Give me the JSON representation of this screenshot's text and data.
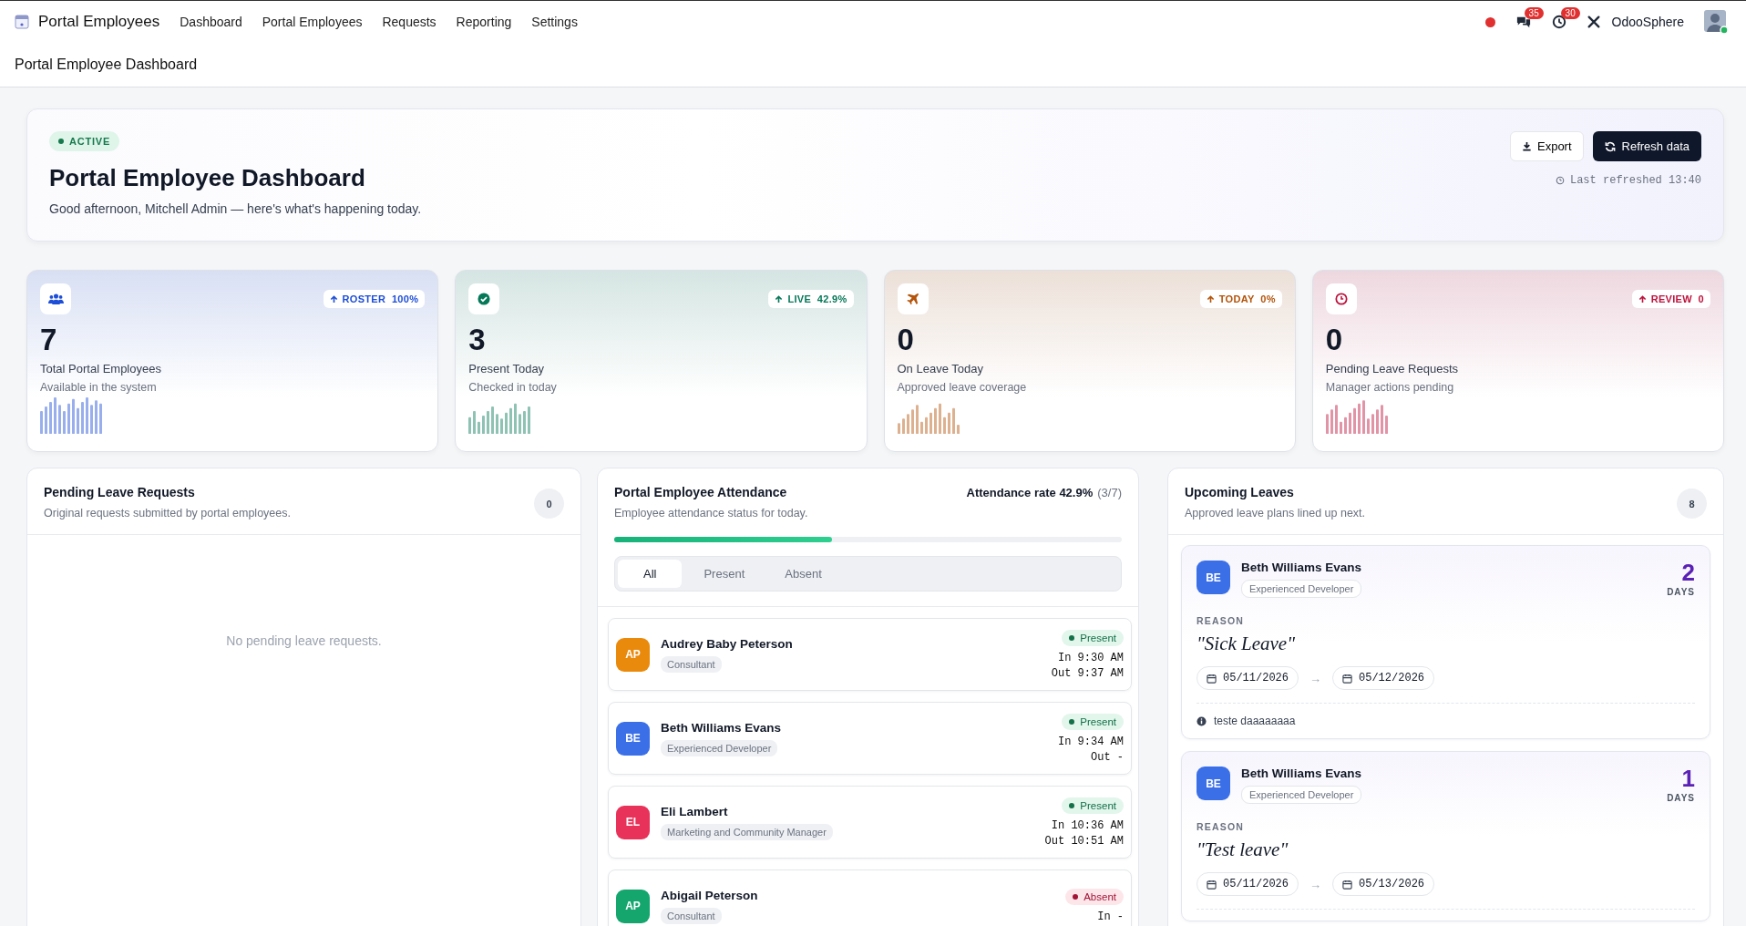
{
  "nav": {
    "brand": "Portal Employees",
    "menu": [
      {
        "label": "Dashboard"
      },
      {
        "label": "Portal Employees"
      },
      {
        "label": "Requests"
      },
      {
        "label": "Reporting"
      },
      {
        "label": "Settings"
      }
    ],
    "chat_count": "35",
    "activity_count": "30",
    "company": "OdooSphere"
  },
  "breadcrumb": "Portal Employee Dashboard",
  "hero": {
    "status": "ACTIVE",
    "title": "Portal Employee Dashboard",
    "greeting": "Good afternoon, Mitchell Admin — here's what's happening today.",
    "export": "Export",
    "refresh": "Refresh data",
    "last_refreshed": "Last refreshed 13:40"
  },
  "stats": [
    {
      "kind": "people",
      "color": "#1d4ed8",
      "badge_label": "ROSTER",
      "badge_value": "100%",
      "value": "7",
      "label": "Total Portal Employees",
      "note": "Available in the system"
    },
    {
      "kind": "check",
      "color": "#047857",
      "badge_label": "LIVE",
      "badge_value": "42.9%",
      "value": "3",
      "label": "Present Today",
      "note": "Checked in today"
    },
    {
      "kind": "plane",
      "color": "#b45309",
      "badge_label": "TODAY",
      "badge_value": "0%",
      "value": "0",
      "label": "On Leave Today",
      "note": "Approved leave coverage"
    },
    {
      "kind": "clock",
      "color": "#be123c",
      "badge_label": "REVIEW",
      "badge_value": "0",
      "value": "0",
      "label": "Pending Leave Requests",
      "note": "Manager actions pending"
    }
  ],
  "pending": {
    "title": "Pending Leave Requests",
    "subtitle": "Original requests submitted by portal employees.",
    "count": "0",
    "empty": "No pending leave requests."
  },
  "attendance": {
    "title": "Portal Employee Attendance",
    "rate_label": "Attendance rate 42.9%",
    "rate_fraction": "(3/7)",
    "subtitle": "Employee attendance status for today.",
    "level": 0.429,
    "tabs": [
      {
        "label": "All",
        "selected": true
      },
      {
        "label": "Present",
        "selected": false
      },
      {
        "label": "Absent",
        "selected": false
      }
    ],
    "rows": [
      {
        "initials": "AP",
        "color": "#ea8a0c",
        "name": "Audrey Baby Peterson",
        "role": "Consultant",
        "kind": "present",
        "status_label": "Present",
        "in": "In 9:30 AM",
        "out": "Out 9:37 AM"
      },
      {
        "initials": "BE",
        "color": "#3b6fe8",
        "name": "Beth Williams Evans",
        "role": "Experienced Developer",
        "kind": "present",
        "status_label": "Present",
        "in": "In 9:34 AM",
        "out": "Out -"
      },
      {
        "initials": "EL",
        "color": "#e8325a",
        "name": "Eli Lambert",
        "role": "Marketing and Community Manager",
        "kind": "present",
        "status_label": "Present",
        "in": "In 10:36 AM",
        "out": "Out 10:51 AM"
      },
      {
        "initials": "AP",
        "color": "#15a66e",
        "name": "Abigail Peterson",
        "role": "Consultant",
        "kind": "absent",
        "status_label": "Absent",
        "in": "In -"
      }
    ]
  },
  "upcoming": {
    "title": "Upcoming Leaves",
    "subtitle": "Approved leave plans lined up next.",
    "count": "8",
    "leaves": [
      {
        "initials": "BE",
        "color": "#3b6fe8",
        "name": "Beth Williams Evans",
        "role": "Experienced Developer",
        "days": "2",
        "days_label": "DAYS",
        "reason_label": "REASON",
        "reason": "\"Sick Leave\"",
        "from": "05/11/2026",
        "arrow": "→",
        "to": "05/12/2026",
        "note": "teste daaaaaaaa"
      },
      {
        "initials": "BE",
        "color": "#3b6fe8",
        "name": "Beth Williams Evans",
        "role": "Experienced Developer",
        "days": "1",
        "days_label": "DAYS",
        "reason_label": "REASON",
        "reason": "\"Test leave\"",
        "from": "05/11/2026",
        "arrow": "→",
        "to": "05/13/2026"
      }
    ]
  }
}
